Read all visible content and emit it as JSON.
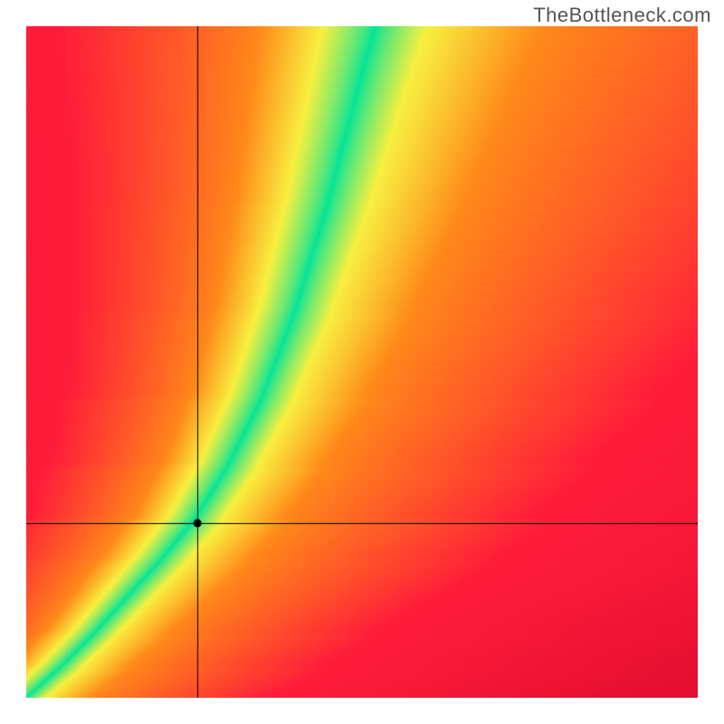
{
  "attribution": "TheBottleneck.com",
  "chart_data": {
    "type": "heatmap",
    "title": "",
    "xlabel": "",
    "ylabel": "",
    "xlim": [
      0,
      1
    ],
    "ylim": [
      0,
      1
    ],
    "crosshair": {
      "x": 0.255,
      "y": 0.26
    },
    "marker": {
      "x": 0.255,
      "y": 0.26
    },
    "ridge": {
      "description": "Green ridge of optimal match running from lower-left corner upward, curving and steepening toward the top edge near x≈0.5",
      "points_xy": [
        [
          0.0,
          0.0
        ],
        [
          0.05,
          0.045
        ],
        [
          0.1,
          0.095
        ],
        [
          0.15,
          0.15
        ],
        [
          0.2,
          0.205
        ],
        [
          0.25,
          0.265
        ],
        [
          0.3,
          0.345
        ],
        [
          0.35,
          0.445
        ],
        [
          0.4,
          0.575
        ],
        [
          0.45,
          0.74
        ],
        [
          0.5,
          0.93
        ],
        [
          0.52,
          1.0
        ]
      ]
    },
    "ridge_width_frac": {
      "bottom": 0.02,
      "top": 0.075
    },
    "color_scale": {
      "on_ridge": "#00E59A",
      "near_ridge": "#F8F040",
      "mid": "#FF8A1A",
      "far": "#FF1E3A"
    },
    "grid": false,
    "legend": false
  }
}
